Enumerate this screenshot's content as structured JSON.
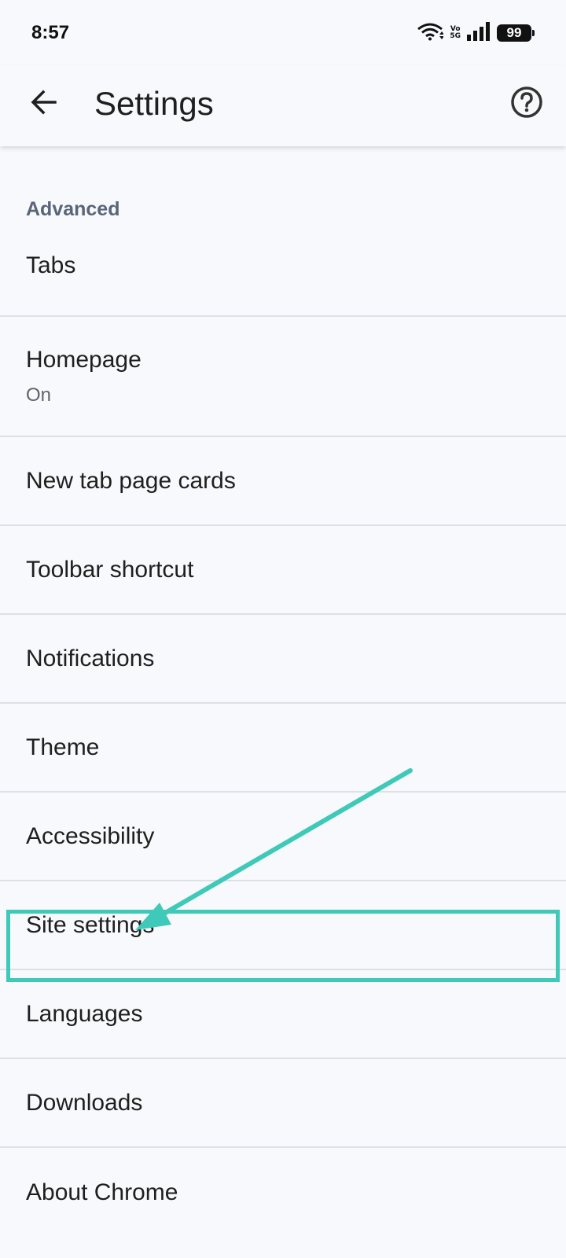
{
  "status_bar": {
    "time": "8:57",
    "volte_top": "Vo",
    "volte_bottom": "5G",
    "battery": "99"
  },
  "app_bar": {
    "title": "Settings",
    "back_icon": "arrow-left-icon",
    "help_icon": "help-circle-icon"
  },
  "settings": {
    "section_header": "Advanced",
    "items": [
      {
        "label": "Tabs"
      },
      {
        "label": "Homepage",
        "sub": "On"
      },
      {
        "label": "New tab page cards"
      },
      {
        "label": "Toolbar shortcut"
      },
      {
        "label": "Notifications"
      },
      {
        "label": "Theme"
      },
      {
        "label": "Accessibility"
      },
      {
        "label": "Site settings"
      },
      {
        "label": "Languages"
      },
      {
        "label": "Downloads"
      },
      {
        "label": "About Chrome"
      }
    ]
  },
  "annotation": {
    "highlight_color": "#3fc9b8",
    "highlighted_item": "Site settings"
  },
  "colors": {
    "background": "#f8f9fc",
    "section_header": "#5a6577",
    "divider": "#dde0e6",
    "text_primary": "#1f1f1f",
    "text_secondary": "#5f6368"
  }
}
